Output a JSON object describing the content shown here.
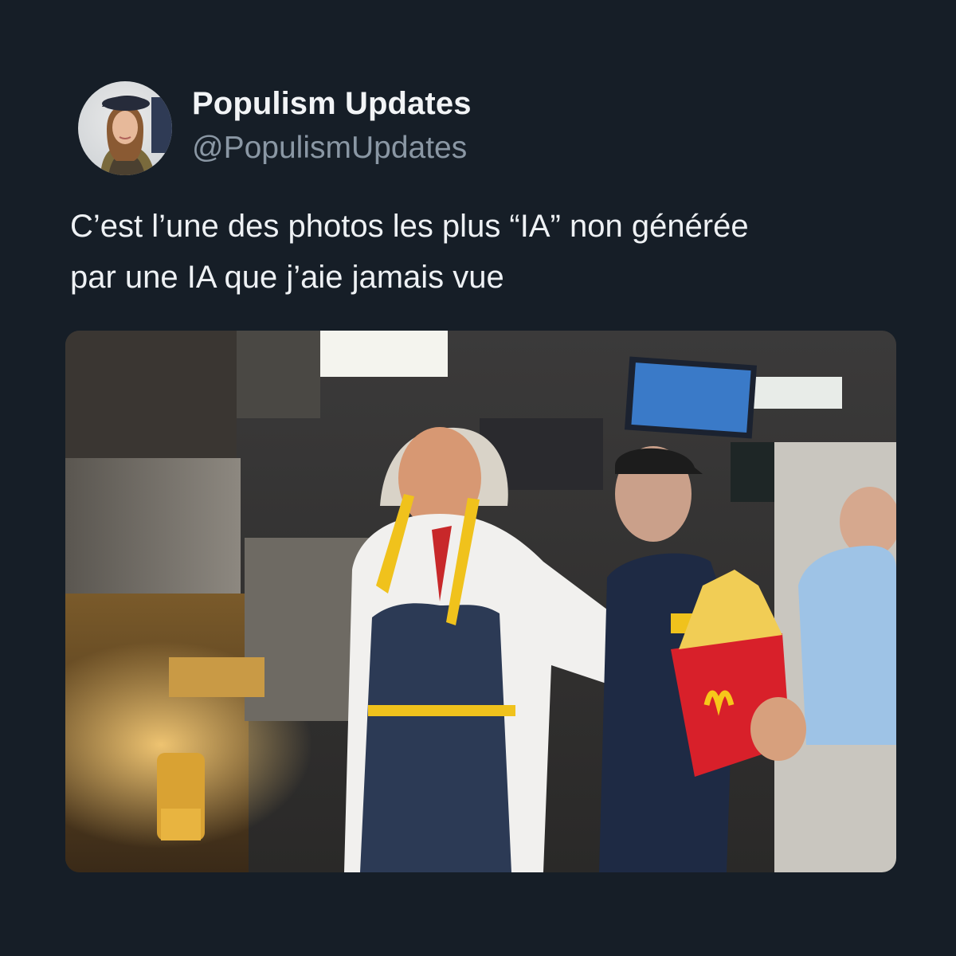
{
  "tweet": {
    "author": {
      "display_name": "Populism Updates",
      "handle": "@PopulismUpdates"
    },
    "text_lines": [
      "C’est l’une des photos les plus “IA” non générée",
      "par une IA que j’aie jamais vue"
    ],
    "media": {
      "icon": "photo"
    }
  },
  "colors": {
    "background": "#161e27",
    "name": "#f2f4f6",
    "handle": "#8a97a4",
    "text": "#eef1f4"
  }
}
